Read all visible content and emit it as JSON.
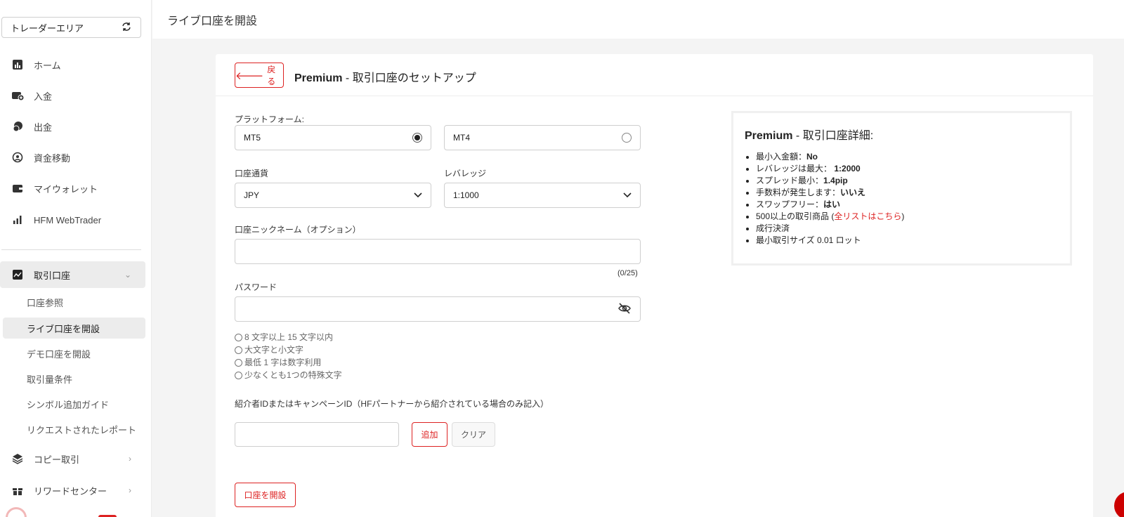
{
  "sidebar": {
    "area_select": "トレーダーエリア",
    "items": [
      {
        "label": "ホーム",
        "icon": "chart-bar-icon"
      },
      {
        "label": "入金",
        "icon": "deposit-icon"
      },
      {
        "label": "出金",
        "icon": "withdraw-icon"
      },
      {
        "label": "資金移動",
        "icon": "transfer-icon"
      },
      {
        "label": "マイウォレット",
        "icon": "wallet-icon"
      },
      {
        "label": "HFM WebTrader",
        "icon": "signal-bars-icon"
      }
    ],
    "trading_accounts": {
      "label": "取引口座",
      "sub_items": [
        {
          "label": "口座参照"
        },
        {
          "label": "ライブ口座を開設"
        },
        {
          "label": "デモ口座を開設"
        },
        {
          "label": "取引量条件"
        },
        {
          "label": "シンボル追加ガイド"
        },
        {
          "label": "リクエストされたレポート"
        }
      ]
    },
    "copy_trading": "コピー取引",
    "reward_center": "リワードセンター"
  },
  "header": {
    "title": "ライブ口座を開設"
  },
  "form": {
    "back_label": "戻る",
    "title_bold": "Premium",
    "title_rest": " - 取引口座のセットアップ",
    "platform_label": "プラットフォーム:",
    "platform_options": [
      {
        "label": "MT5",
        "selected": true
      },
      {
        "label": "MT4",
        "selected": false
      }
    ],
    "currency_label": "口座通貨",
    "currency_value": "JPY",
    "leverage_label": "レバレッジ",
    "leverage_value": "1:1000",
    "nickname_label": "口座ニックネーム（オプション）",
    "nickname_value": "",
    "nickname_counter": "(0/25)",
    "password_label": "パスワード",
    "password_value": "",
    "password_rules": [
      "8 文字以上 15 文字以内",
      "大文字と小文字",
      "最低 1 字は数字利用",
      "少なくとも1つの特殊文字"
    ],
    "referral_label": "紹介者IDまたはキャンペーンID（HFパートナーから紹介されている場合のみ記入）",
    "referral_value": "",
    "add_label": "追加",
    "clear_label": "クリア",
    "open_label": "口座を開設"
  },
  "details": {
    "title_bold": "Premium",
    "title_rest": " - 取引口座詳細:",
    "min_deposit_label": "最小入金額：",
    "min_deposit_value": "No",
    "leverage_label": "レバレッジは最大：",
    "leverage_value": "1:2000",
    "spread_label": "スプレッド最小：",
    "spread_value": "1.4pip",
    "commission_label": "手数料が発生します：",
    "commission_value": "いいえ",
    "swap_label": "スワップフリー：",
    "swap_value": "はい",
    "instruments_prefix": "500以上の取引商品 (",
    "instruments_link": "全リストはこちら",
    "instruments_suffix": ")",
    "execution": "成行決済",
    "min_lot": "最小取引サイズ 0.01 ロット"
  },
  "colors": {
    "accent": "#dd2222",
    "sidebar_active": "#ececec"
  }
}
